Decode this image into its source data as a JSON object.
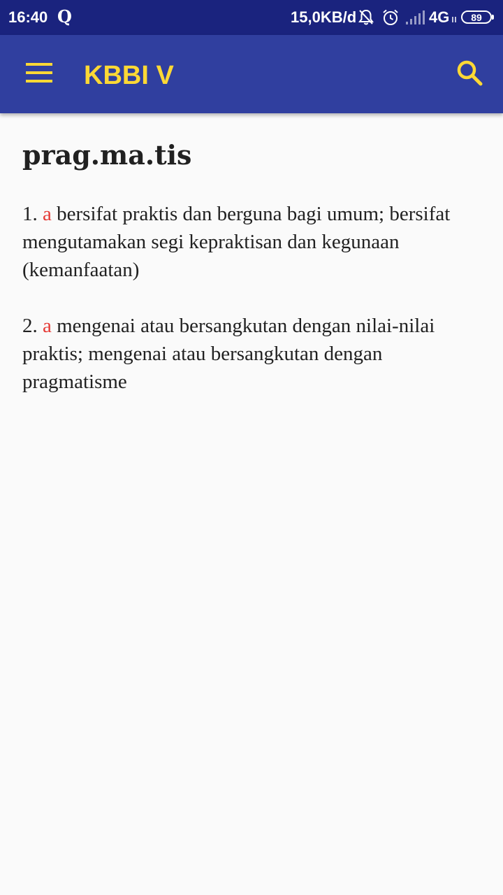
{
  "status_bar": {
    "time": "16:40",
    "notification_app": "Q",
    "speed": "15,0KB/d",
    "network": "4G",
    "battery": "89",
    "icons": [
      "bell-off-icon",
      "alarm-icon",
      "signal-icon"
    ]
  },
  "app_bar": {
    "title": "KBBI V",
    "menu_icon": "menu-icon",
    "search_icon": "search-icon"
  },
  "entry": {
    "headword": "prag.ma.tis",
    "definitions": [
      {
        "number": "1.",
        "pos": "a",
        "text": "bersifat praktis dan berguna bagi umum; bersifat mengutamakan segi kepraktisan dan kegunaan (kemanfaatan)"
      },
      {
        "number": "2.",
        "pos": "a",
        "text": "mengenai atau bersangkutan dengan nilai-nilai praktis; mengenai atau bersangkutan dengan pragmatisme"
      }
    ]
  },
  "colors": {
    "status_bar": "#1a237e",
    "app_bar": "#303f9f",
    "accent": "#fdd835",
    "pos_label": "#e53935",
    "text": "#212121",
    "background": "#fafafa"
  }
}
